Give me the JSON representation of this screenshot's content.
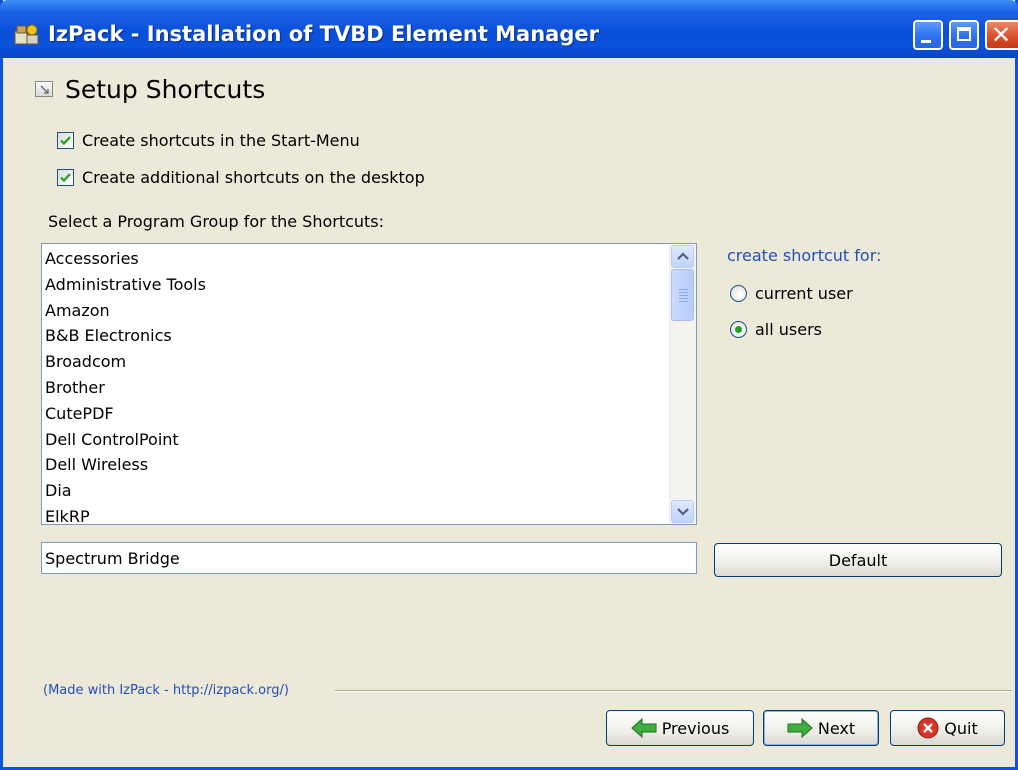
{
  "window": {
    "title": "IzPack - Installation of  TVBD Element Manager",
    "title_icon": "izpack-app-icon",
    "controls": [
      "minimize-icon",
      "maximize-icon",
      "close-icon"
    ],
    "titlebar_color": "#0a4fd8"
  },
  "panel": {
    "title": "Setup Shortcuts",
    "icon": "setup-icon"
  },
  "options": {
    "start_menu": {
      "label": "Create shortcuts in the Start-Menu",
      "checked": true
    },
    "desktop": {
      "label": "Create additional shortcuts on the desktop",
      "checked": true
    }
  },
  "program_group": {
    "label": "Select a Program Group for the Shortcuts:",
    "items": [
      "Accessories",
      "Administrative Tools",
      "Amazon",
      "B&B Electronics",
      "Broadcom",
      "Brother",
      "CutePDF",
      "Dell ControlPoint",
      "Dell Wireless",
      "Dia",
      "ElkRP"
    ],
    "value": "Spectrum Bridge",
    "default_button": "Default"
  },
  "shortcut_for": {
    "label": "create shortcut for:",
    "options": [
      {
        "label": "current user",
        "selected": false
      },
      {
        "label": "all users",
        "selected": true
      }
    ],
    "label_color": "#2250b8"
  },
  "footer": {
    "made_with": "(Made with IzPack - http://izpack.org/)",
    "previous": "Previous",
    "next": "Next",
    "quit": "Quit"
  }
}
